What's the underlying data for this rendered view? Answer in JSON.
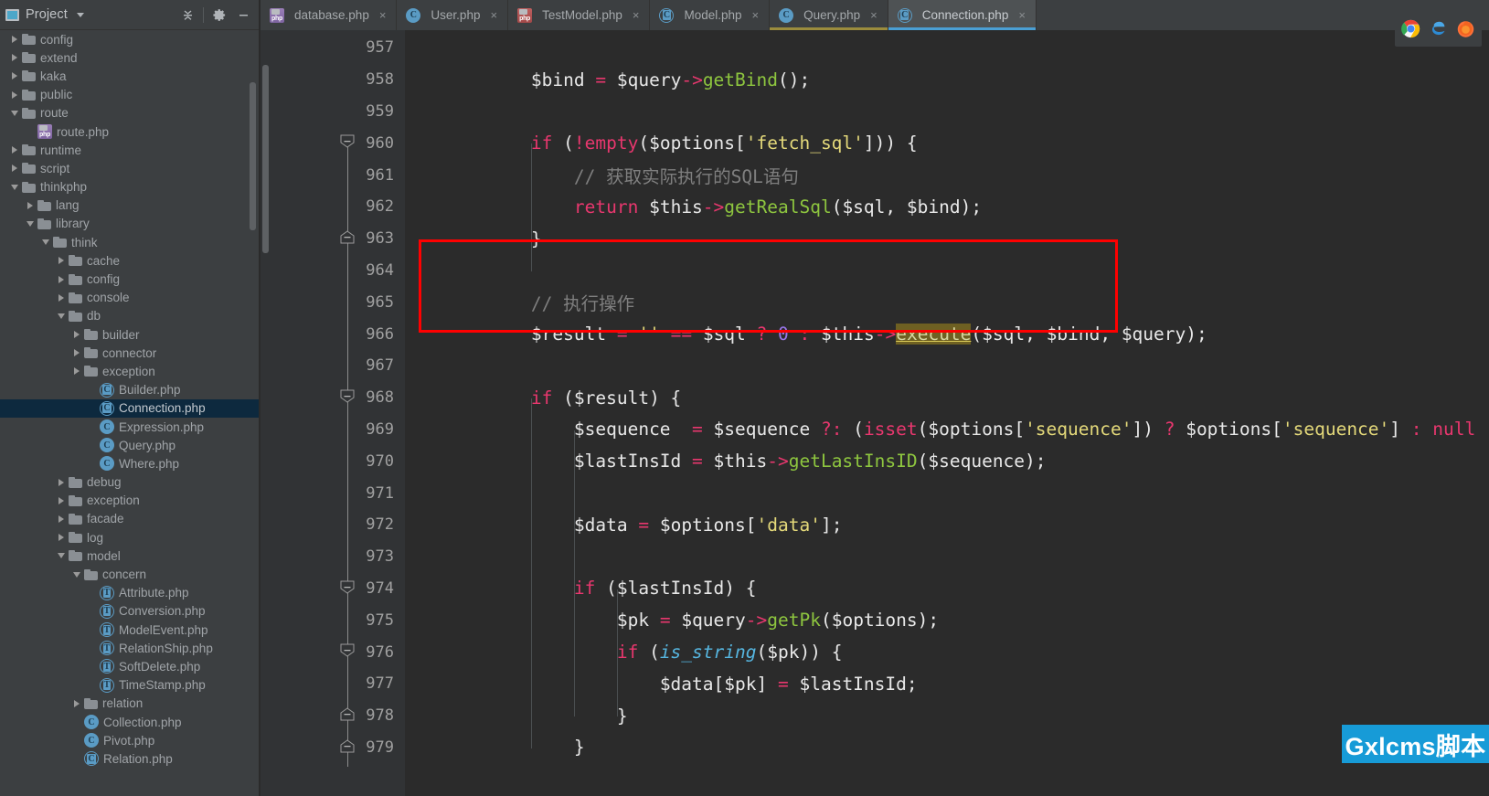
{
  "panel": {
    "title": "Project",
    "icons": {
      "project": "project-window-icon",
      "chevron": "chevron-down-icon",
      "collapse_all": "collapse-all-icon",
      "settings": "gear-icon",
      "hide": "minimize-icon"
    },
    "tree": [
      {
        "label": "config",
        "depth": 0,
        "state": "collapsed",
        "type": "folder"
      },
      {
        "label": "extend",
        "depth": 0,
        "state": "collapsed",
        "type": "folder"
      },
      {
        "label": "kaka",
        "depth": 0,
        "state": "collapsed",
        "type": "folder"
      },
      {
        "label": "public",
        "depth": 0,
        "state": "collapsed",
        "type": "folder"
      },
      {
        "label": "route",
        "depth": 0,
        "state": "expanded",
        "type": "folder"
      },
      {
        "label": "route.php",
        "depth": 1,
        "state": "leaf",
        "type": "php"
      },
      {
        "label": "runtime",
        "depth": 0,
        "state": "collapsed",
        "type": "folder"
      },
      {
        "label": "script",
        "depth": 0,
        "state": "collapsed",
        "type": "folder"
      },
      {
        "label": "thinkphp",
        "depth": 0,
        "state": "expanded",
        "type": "folder"
      },
      {
        "label": "lang",
        "depth": 1,
        "state": "collapsed",
        "type": "folder"
      },
      {
        "label": "library",
        "depth": 1,
        "state": "expanded",
        "type": "folder"
      },
      {
        "label": "think",
        "depth": 2,
        "state": "expanded",
        "type": "folder"
      },
      {
        "label": "cache",
        "depth": 3,
        "state": "collapsed",
        "type": "folder"
      },
      {
        "label": "config",
        "depth": 3,
        "state": "collapsed",
        "type": "folder"
      },
      {
        "label": "console",
        "depth": 3,
        "state": "collapsed",
        "type": "folder"
      },
      {
        "label": "db",
        "depth": 3,
        "state": "expanded",
        "type": "folder"
      },
      {
        "label": "builder",
        "depth": 4,
        "state": "collapsed",
        "type": "folder"
      },
      {
        "label": "connector",
        "depth": 4,
        "state": "collapsed",
        "type": "folder"
      },
      {
        "label": "exception",
        "depth": 4,
        "state": "collapsed",
        "type": "folder"
      },
      {
        "label": "Builder.php",
        "depth": 5,
        "state": "leaf",
        "type": "abstract-class"
      },
      {
        "label": "Connection.php",
        "depth": 5,
        "state": "leaf",
        "type": "abstract-class",
        "selected": true
      },
      {
        "label": "Expression.php",
        "depth": 5,
        "state": "leaf",
        "type": "class"
      },
      {
        "label": "Query.php",
        "depth": 5,
        "state": "leaf",
        "type": "class"
      },
      {
        "label": "Where.php",
        "depth": 5,
        "state": "leaf",
        "type": "class"
      },
      {
        "label": "debug",
        "depth": 3,
        "state": "collapsed",
        "type": "folder"
      },
      {
        "label": "exception",
        "depth": 3,
        "state": "collapsed",
        "type": "folder"
      },
      {
        "label": "facade",
        "depth": 3,
        "state": "collapsed",
        "type": "folder"
      },
      {
        "label": "log",
        "depth": 3,
        "state": "collapsed",
        "type": "folder"
      },
      {
        "label": "model",
        "depth": 3,
        "state": "expanded",
        "type": "folder"
      },
      {
        "label": "concern",
        "depth": 4,
        "state": "expanded",
        "type": "folder"
      },
      {
        "label": "Attribute.php",
        "depth": 5,
        "state": "leaf",
        "type": "trait"
      },
      {
        "label": "Conversion.php",
        "depth": 5,
        "state": "leaf",
        "type": "trait"
      },
      {
        "label": "ModelEvent.php",
        "depth": 5,
        "state": "leaf",
        "type": "trait"
      },
      {
        "label": "RelationShip.php",
        "depth": 5,
        "state": "leaf",
        "type": "trait"
      },
      {
        "label": "SoftDelete.php",
        "depth": 5,
        "state": "leaf",
        "type": "trait"
      },
      {
        "label": "TimeStamp.php",
        "depth": 5,
        "state": "leaf",
        "type": "trait"
      },
      {
        "label": "relation",
        "depth": 4,
        "state": "collapsed",
        "type": "folder"
      },
      {
        "label": "Collection.php",
        "depth": 4,
        "state": "leaf",
        "type": "class"
      },
      {
        "label": "Pivot.php",
        "depth": 4,
        "state": "leaf",
        "type": "class"
      },
      {
        "label": "Relation.php",
        "depth": 4,
        "state": "leaf",
        "type": "abstract-class"
      }
    ]
  },
  "tabs": [
    {
      "label": "database.php",
      "type": "php",
      "active": false,
      "closable": true
    },
    {
      "label": "User.php",
      "type": "class",
      "active": false,
      "closable": true
    },
    {
      "label": "TestModel.php",
      "type": "php-model",
      "active": false,
      "closable": true
    },
    {
      "label": "Model.php",
      "type": "abstract-class",
      "active": false,
      "closable": true
    },
    {
      "label": "Query.php",
      "type": "class",
      "active": false,
      "closable": true,
      "modified": true
    },
    {
      "label": "Connection.php",
      "type": "abstract-class",
      "active": true,
      "closable": true
    }
  ],
  "editor": {
    "first_line": 957,
    "lines": [
      {
        "num": 957,
        "tokens": []
      },
      {
        "num": 958,
        "tokens": [
          {
            "t": "        ",
            "c": "punc"
          },
          {
            "t": "$bind",
            "c": "var"
          },
          {
            "t": " ",
            "c": "punc"
          },
          {
            "t": "=",
            "c": "op"
          },
          {
            "t": " ",
            "c": "punc"
          },
          {
            "t": "$query",
            "c": "var"
          },
          {
            "t": "->",
            "c": "arrow-op"
          },
          {
            "t": "getBind",
            "c": "fn"
          },
          {
            "t": "();",
            "c": "punc"
          }
        ]
      },
      {
        "num": 959,
        "tokens": []
      },
      {
        "num": 960,
        "fold": "down",
        "tokens": [
          {
            "t": "        ",
            "c": "punc"
          },
          {
            "t": "if",
            "c": "kwp"
          },
          {
            "t": " (",
            "c": "punc"
          },
          {
            "t": "!",
            "c": "op"
          },
          {
            "t": "empty",
            "c": "kwp"
          },
          {
            "t": "(",
            "c": "punc"
          },
          {
            "t": "$options",
            "c": "var"
          },
          {
            "t": "[",
            "c": "punc"
          },
          {
            "t": "'fetch_sql'",
            "c": "str"
          },
          {
            "t": "])) {",
            "c": "punc"
          }
        ]
      },
      {
        "num": 961,
        "tokens": [
          {
            "t": "            ",
            "c": "punc"
          },
          {
            "t": "// 获取实际执行的SQL语句",
            "c": "cmt"
          }
        ]
      },
      {
        "num": 962,
        "tokens": [
          {
            "t": "            ",
            "c": "punc"
          },
          {
            "t": "return",
            "c": "kwp"
          },
          {
            "t": " ",
            "c": "punc"
          },
          {
            "t": "$this",
            "c": "var"
          },
          {
            "t": "->",
            "c": "arrow-op"
          },
          {
            "t": "getRealSql",
            "c": "fn"
          },
          {
            "t": "(",
            "c": "punc"
          },
          {
            "t": "$sql",
            "c": "var"
          },
          {
            "t": ", ",
            "c": "punc"
          },
          {
            "t": "$bind",
            "c": "var"
          },
          {
            "t": ");",
            "c": "punc"
          }
        ]
      },
      {
        "num": 963,
        "fold": "up",
        "tokens": [
          {
            "t": "        }",
            "c": "punc"
          }
        ]
      },
      {
        "num": 964,
        "tokens": []
      },
      {
        "num": 965,
        "tokens": [
          {
            "t": "        ",
            "c": "punc"
          },
          {
            "t": "// 执行操作",
            "c": "cmt"
          }
        ]
      },
      {
        "num": 966,
        "tokens": [
          {
            "t": "        ",
            "c": "punc"
          },
          {
            "t": "$result",
            "c": "var"
          },
          {
            "t": " ",
            "c": "punc"
          },
          {
            "t": "=",
            "c": "op"
          },
          {
            "t": " ",
            "c": "punc"
          },
          {
            "t": "''",
            "c": "str"
          },
          {
            "t": " ",
            "c": "punc"
          },
          {
            "t": "==",
            "c": "op"
          },
          {
            "t": " ",
            "c": "punc"
          },
          {
            "t": "$sql",
            "c": "var"
          },
          {
            "t": " ",
            "c": "punc"
          },
          {
            "t": "?",
            "c": "op"
          },
          {
            "t": " ",
            "c": "punc"
          },
          {
            "t": "0",
            "c": "num"
          },
          {
            "t": " ",
            "c": "punc"
          },
          {
            "t": ":",
            "c": "op"
          },
          {
            "t": " ",
            "c": "punc"
          },
          {
            "t": "$this",
            "c": "var"
          },
          {
            "t": "->",
            "c": "arrow-op"
          },
          {
            "t": "execute",
            "c": "hl-exec"
          },
          {
            "t": "(",
            "c": "punc"
          },
          {
            "t": "$sql",
            "c": "var"
          },
          {
            "t": ", ",
            "c": "punc"
          },
          {
            "t": "$bind",
            "c": "var"
          },
          {
            "t": ", ",
            "c": "punc"
          },
          {
            "t": "$query",
            "c": "var"
          },
          {
            "t": ");",
            "c": "punc"
          }
        ]
      },
      {
        "num": 967,
        "tokens": []
      },
      {
        "num": 968,
        "fold": "down",
        "tokens": [
          {
            "t": "        ",
            "c": "punc"
          },
          {
            "t": "if",
            "c": "kwp"
          },
          {
            "t": " (",
            "c": "punc"
          },
          {
            "t": "$result",
            "c": "var"
          },
          {
            "t": ") {",
            "c": "punc"
          }
        ]
      },
      {
        "num": 969,
        "tokens": [
          {
            "t": "            ",
            "c": "punc"
          },
          {
            "t": "$sequence",
            "c": "var"
          },
          {
            "t": "  ",
            "c": "punc"
          },
          {
            "t": "=",
            "c": "op"
          },
          {
            "t": " ",
            "c": "punc"
          },
          {
            "t": "$sequence",
            "c": "var"
          },
          {
            "t": " ",
            "c": "punc"
          },
          {
            "t": "?:",
            "c": "op"
          },
          {
            "t": " (",
            "c": "punc"
          },
          {
            "t": "isset",
            "c": "kwp"
          },
          {
            "t": "(",
            "c": "punc"
          },
          {
            "t": "$options",
            "c": "var"
          },
          {
            "t": "[",
            "c": "punc"
          },
          {
            "t": "'sequence'",
            "c": "str"
          },
          {
            "t": "]) ",
            "c": "punc"
          },
          {
            "t": "?",
            "c": "op"
          },
          {
            "t": " ",
            "c": "punc"
          },
          {
            "t": "$options",
            "c": "var"
          },
          {
            "t": "[",
            "c": "punc"
          },
          {
            "t": "'sequence'",
            "c": "str"
          },
          {
            "t": "] ",
            "c": "punc"
          },
          {
            "t": ":",
            "c": "op"
          },
          {
            "t": " ",
            "c": "punc"
          },
          {
            "t": "null",
            "c": "kwp"
          },
          {
            "t": ");",
            "c": "punc"
          }
        ]
      },
      {
        "num": 970,
        "tokens": [
          {
            "t": "            ",
            "c": "punc"
          },
          {
            "t": "$lastInsId",
            "c": "var"
          },
          {
            "t": " ",
            "c": "punc"
          },
          {
            "t": "=",
            "c": "op"
          },
          {
            "t": " ",
            "c": "punc"
          },
          {
            "t": "$this",
            "c": "var"
          },
          {
            "t": "->",
            "c": "arrow-op"
          },
          {
            "t": "getLastInsID",
            "c": "fn"
          },
          {
            "t": "(",
            "c": "punc"
          },
          {
            "t": "$sequence",
            "c": "var"
          },
          {
            "t": ");",
            "c": "punc"
          }
        ]
      },
      {
        "num": 971,
        "tokens": []
      },
      {
        "num": 972,
        "tokens": [
          {
            "t": "            ",
            "c": "punc"
          },
          {
            "t": "$data",
            "c": "var"
          },
          {
            "t": " ",
            "c": "punc"
          },
          {
            "t": "=",
            "c": "op"
          },
          {
            "t": " ",
            "c": "punc"
          },
          {
            "t": "$options",
            "c": "var"
          },
          {
            "t": "[",
            "c": "punc"
          },
          {
            "t": "'data'",
            "c": "str"
          },
          {
            "t": "];",
            "c": "punc"
          }
        ]
      },
      {
        "num": 973,
        "tokens": []
      },
      {
        "num": 974,
        "fold": "down",
        "tokens": [
          {
            "t": "            ",
            "c": "punc"
          },
          {
            "t": "if",
            "c": "kwp"
          },
          {
            "t": " (",
            "c": "punc"
          },
          {
            "t": "$lastInsId",
            "c": "var"
          },
          {
            "t": ") {",
            "c": "punc"
          }
        ]
      },
      {
        "num": 975,
        "tokens": [
          {
            "t": "                ",
            "c": "punc"
          },
          {
            "t": "$pk",
            "c": "var"
          },
          {
            "t": " ",
            "c": "punc"
          },
          {
            "t": "=",
            "c": "op"
          },
          {
            "t": " ",
            "c": "punc"
          },
          {
            "t": "$query",
            "c": "var"
          },
          {
            "t": "->",
            "c": "arrow-op"
          },
          {
            "t": "getPk",
            "c": "fn"
          },
          {
            "t": "(",
            "c": "punc"
          },
          {
            "t": "$options",
            "c": "var"
          },
          {
            "t": ");",
            "c": "punc"
          }
        ]
      },
      {
        "num": 976,
        "fold": "down",
        "tokens": [
          {
            "t": "                ",
            "c": "punc"
          },
          {
            "t": "if",
            "c": "kwp"
          },
          {
            "t": " (",
            "c": "punc"
          },
          {
            "t": "is_string",
            "c": "builtin"
          },
          {
            "t": "(",
            "c": "punc"
          },
          {
            "t": "$pk",
            "c": "var"
          },
          {
            "t": ")) {",
            "c": "punc"
          }
        ]
      },
      {
        "num": 977,
        "tokens": [
          {
            "t": "                    ",
            "c": "punc"
          },
          {
            "t": "$data",
            "c": "var"
          },
          {
            "t": "[",
            "c": "punc"
          },
          {
            "t": "$pk",
            "c": "var"
          },
          {
            "t": "] ",
            "c": "punc"
          },
          {
            "t": "=",
            "c": "op"
          },
          {
            "t": " ",
            "c": "punc"
          },
          {
            "t": "$lastInsId",
            "c": "var"
          },
          {
            "t": ";",
            "c": "punc"
          }
        ]
      },
      {
        "num": 978,
        "fold": "up",
        "tokens": [
          {
            "t": "                }",
            "c": "punc"
          }
        ]
      },
      {
        "num": 979,
        "fold": "up",
        "tokens": [
          {
            "t": "            }",
            "c": "punc"
          }
        ]
      }
    ],
    "highlight_box": {
      "color": "#ff0000",
      "around_lines": [
        965,
        966
      ]
    }
  },
  "browser_bar": {
    "icons": [
      "chrome-icon",
      "edge-icon",
      "firefox-icon"
    ]
  },
  "watermark": {
    "text": "Gxlcms脚本",
    "bg": "#179bd7",
    "fg": "#ffffff"
  }
}
